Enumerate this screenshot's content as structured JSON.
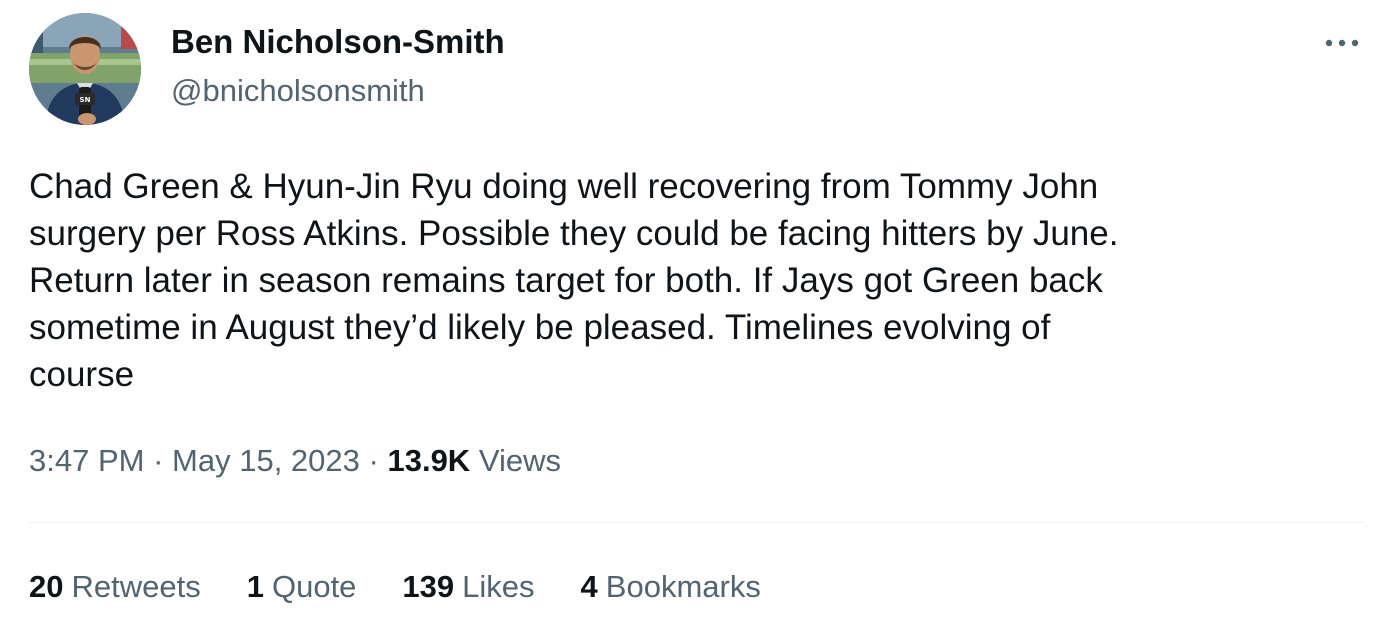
{
  "author": {
    "display_name": "Ben Nicholson-Smith",
    "handle": "@bnicholsonsmith",
    "avatar_label": "SN"
  },
  "tweet": {
    "text": "Chad Green & Hyun-Jin Ryu doing well recovering from Tommy John\nsurgery per Ross Atkins. Possible they could be facing hitters by June.\nReturn later in season remains target for both. If Jays got Green back\nsometime in August they’d likely be pleased. Timelines evolving of\ncourse",
    "time": "3:47 PM",
    "separator": "·",
    "date": "May 15, 2023",
    "views_count": "13.9K",
    "views_label": "Views"
  },
  "stats": {
    "retweets_count": "20",
    "retweets_label": "Retweets",
    "quotes_count": "1",
    "quotes_label": "Quote",
    "likes_count": "139",
    "likes_label": "Likes",
    "bookmarks_count": "4",
    "bookmarks_label": "Bookmarks"
  },
  "icons": {
    "more": "more-horizontal-icon"
  },
  "colors": {
    "text_primary": "#0f1419",
    "text_secondary": "#536471",
    "divider": "#eff3f4"
  }
}
